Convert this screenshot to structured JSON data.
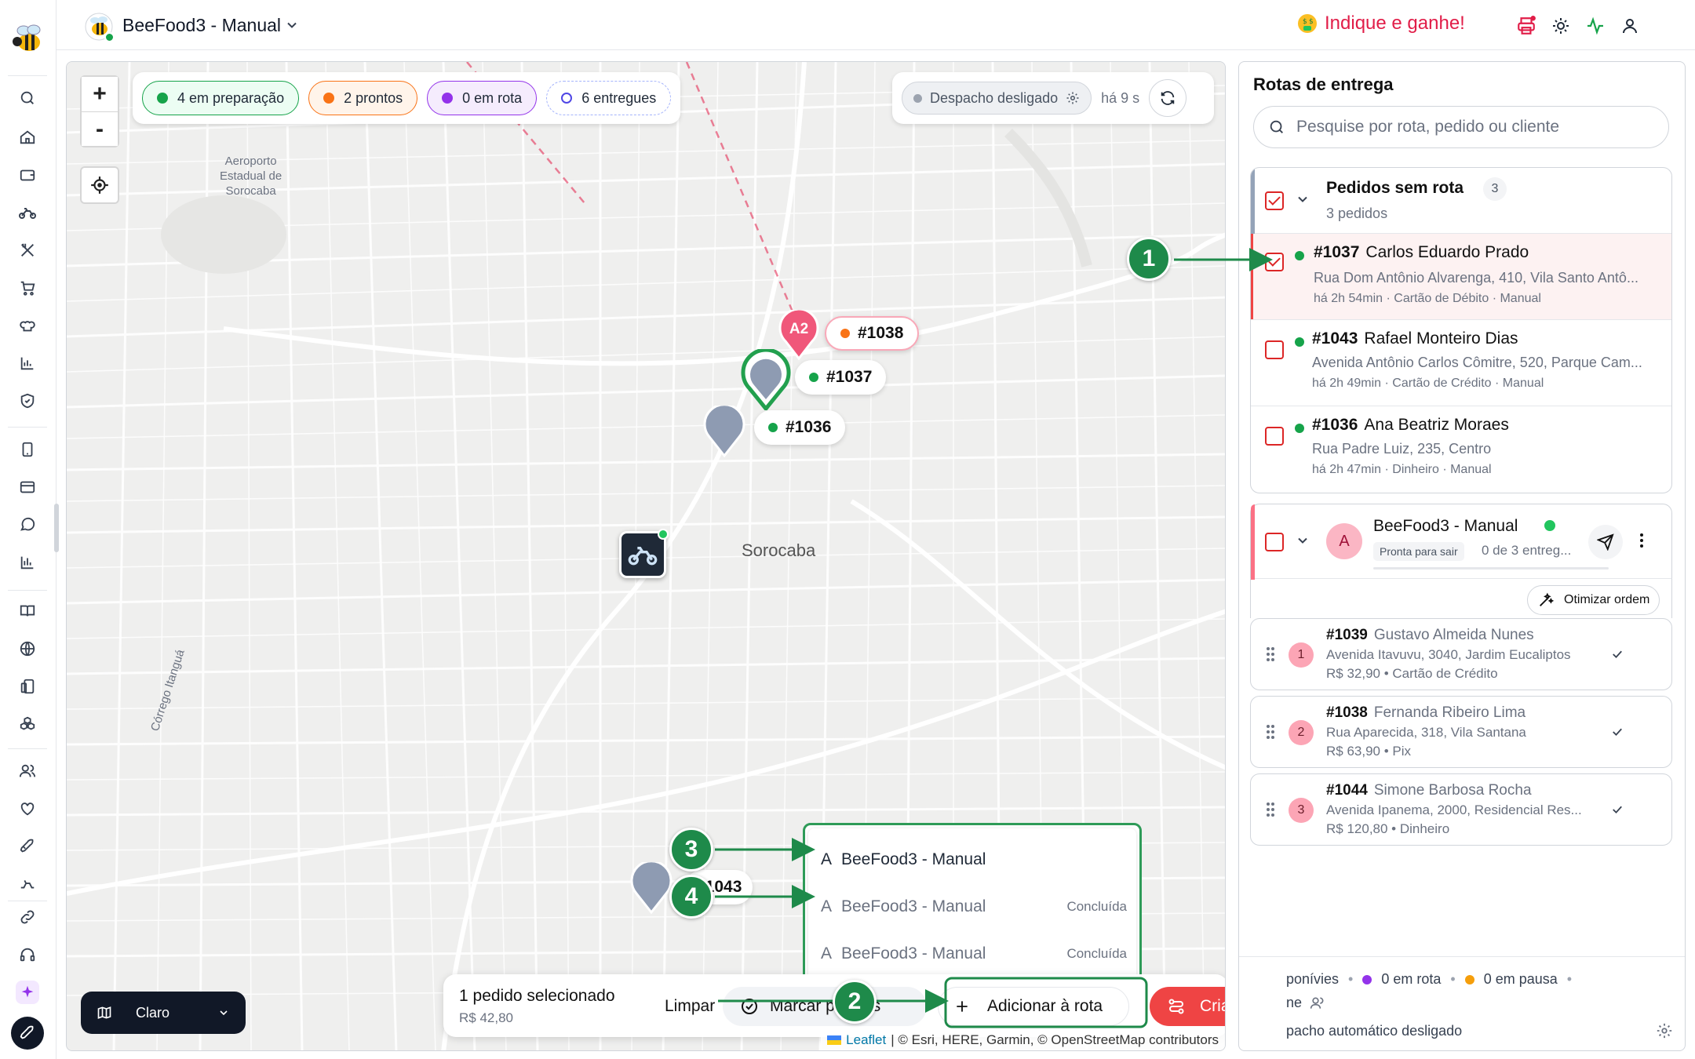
{
  "app": {
    "store_name": "BeeFood3 - Manual",
    "refer_label": "Indique e ganhe!"
  },
  "map": {
    "status_chips": [
      {
        "label": "4 em preparação",
        "color": "#16a34a"
      },
      {
        "label": "2 prontos",
        "color": "#f97316"
      },
      {
        "label": "0 em rota",
        "color": "#9333ea"
      },
      {
        "label": "6 entregues",
        "color": "#4f46e5"
      }
    ],
    "dispatch_label": "Despacho desligado",
    "dispatch_ago": "há 9 s",
    "city_label": "Sorocaba",
    "airport_label": [
      "Aeroporto",
      "Estadual de",
      "Sorocaba"
    ],
    "creek_label": "Córrego Itanguá",
    "route_pin_label": "A2",
    "pins": [
      "#1038",
      "#1037",
      "#1036",
      "#1043"
    ],
    "zoom_in": "+",
    "zoom_out": "-",
    "theme_label": "Claro",
    "attribution_leaflet": "Leaflet",
    "attribution_rest": "| © Esri, HERE, Garmin, © OpenStreetMap contributors"
  },
  "action_bar": {
    "selected_title": "1 pedido selecionado",
    "selected_total": "R$ 42,80",
    "clear_label": "Limpar",
    "mark_ready_label": "Marcar prontos",
    "add_to_route_label": "Adicionar à rota",
    "create_route_label": "Criar rota"
  },
  "route_dropdown": [
    {
      "letter": "A",
      "name": "BeeFood3 - Manual",
      "status": ""
    },
    {
      "letter": "A",
      "name": "BeeFood3 - Manual",
      "status": "Concluída"
    },
    {
      "letter": "A",
      "name": "BeeFood3 - Manual",
      "status": "Concluída"
    }
  ],
  "callouts": [
    "1",
    "2",
    "3",
    "4"
  ],
  "panel": {
    "title": "Rotas de entrega",
    "search_placeholder": "Pesquise por rota, pedido ou cliente",
    "unrouted": {
      "title": "Pedidos sem rota",
      "count": "3",
      "subtitle": "3 pedidos",
      "orders": [
        {
          "id": "#1037",
          "customer": "Carlos Eduardo Prado",
          "address": "Rua Dom Antônio Alvarenga, 410, Vila Santo Antô...",
          "meta": "há 2h 54min · Cartão de Débito · Manual"
        },
        {
          "id": "#1043",
          "customer": "Rafael Monteiro Dias",
          "address": "Avenida Antônio Carlos Cômitre, 520, Parque Cam...",
          "meta": "há 2h 49min · Cartão de Crédito · Manual"
        },
        {
          "id": "#1036",
          "customer": "Ana Beatriz Moraes",
          "address": "Rua Padre Luiz, 235, Centro",
          "meta": "há 2h 47min · Dinheiro · Manual"
        }
      ]
    },
    "route": {
      "avatar": "A",
      "name": "BeeFood3 - Manual",
      "status_badge": "Pronta para sair",
      "progress": "0 de 3 entreg...",
      "optimize_label": "Otimizar ordem",
      "stops": [
        {
          "n": "1",
          "id": "#1039",
          "customer": "Gustavo Almeida Nunes",
          "address": "Avenida Itavuvu, 3040, Jardim Eucaliptos",
          "meta": "R$ 32,90 • Cartão de Crédito"
        },
        {
          "n": "2",
          "id": "#1038",
          "customer": "Fernanda Ribeiro Lima",
          "address": "Rua Aparecida, 318, Vila Santana",
          "meta": "R$ 63,90 • Pix"
        },
        {
          "n": "3",
          "id": "#1044",
          "customer": "Simone Barbosa Rocha",
          "address": "Avenida Ipanema, 2000, Residencial Res...",
          "meta": "R$ 120,80 • Dinheiro"
        }
      ]
    },
    "legend": {
      "available": "ponívies",
      "in_route": "0 em rota",
      "paused": "0 em pausa",
      "line2": "ne",
      "auto_dispatch": "pacho automático desligado"
    }
  }
}
